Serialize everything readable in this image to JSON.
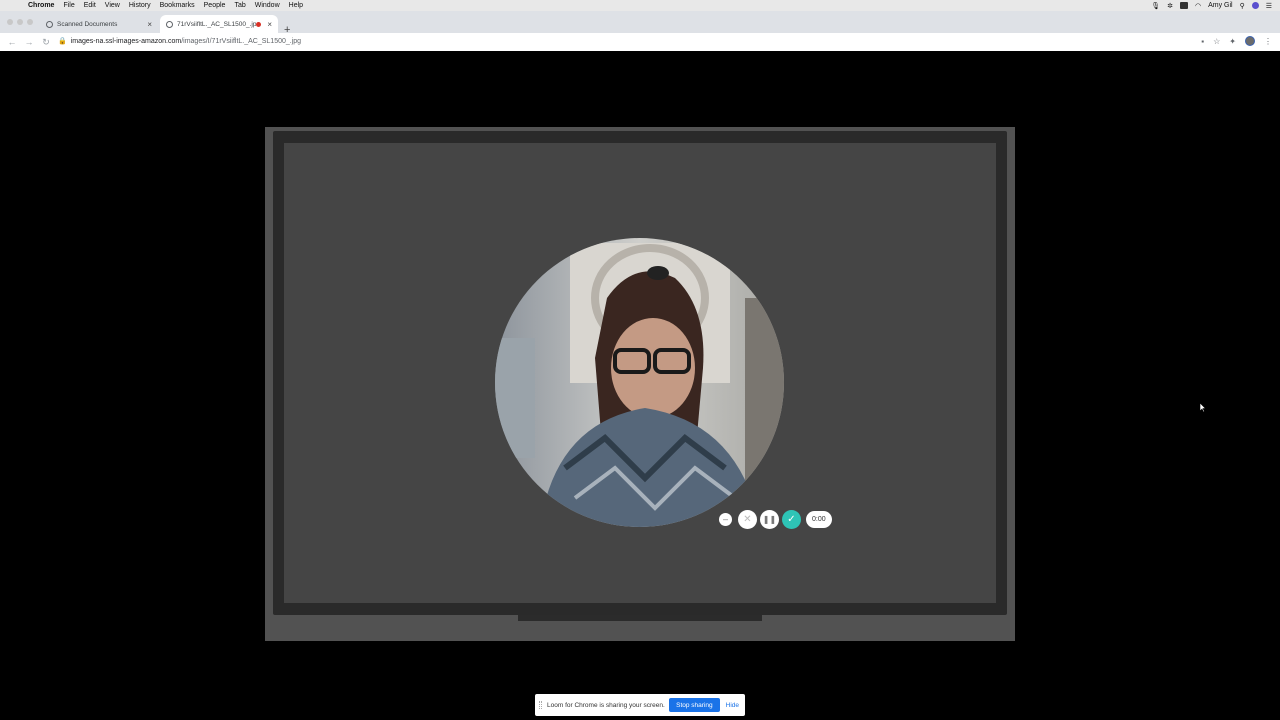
{
  "menubar": {
    "app": "Chrome",
    "items": [
      "File",
      "Edit",
      "View",
      "History",
      "Bookmarks",
      "People",
      "Tab",
      "Window",
      "Help"
    ],
    "user": "Amy Gil"
  },
  "tabs": [
    {
      "title": "Scanned Documents",
      "active": false
    },
    {
      "title": "71rVsiifltL._AC_SL1500_.jp",
      "active": true,
      "recording": true
    }
  ],
  "address_bar": {
    "domain": "images-na.ssl-images-amazon.com",
    "path": "/images/I/71rVsiifltL._AC_SL1500_.jpg"
  },
  "loom_controls": {
    "timer": "0:00",
    "accent_color": "#2ec4b6"
  },
  "share_bar": {
    "message": "Loom for Chrome is sharing your screen.",
    "stop_label": "Stop sharing",
    "hide_label": "Hide"
  }
}
